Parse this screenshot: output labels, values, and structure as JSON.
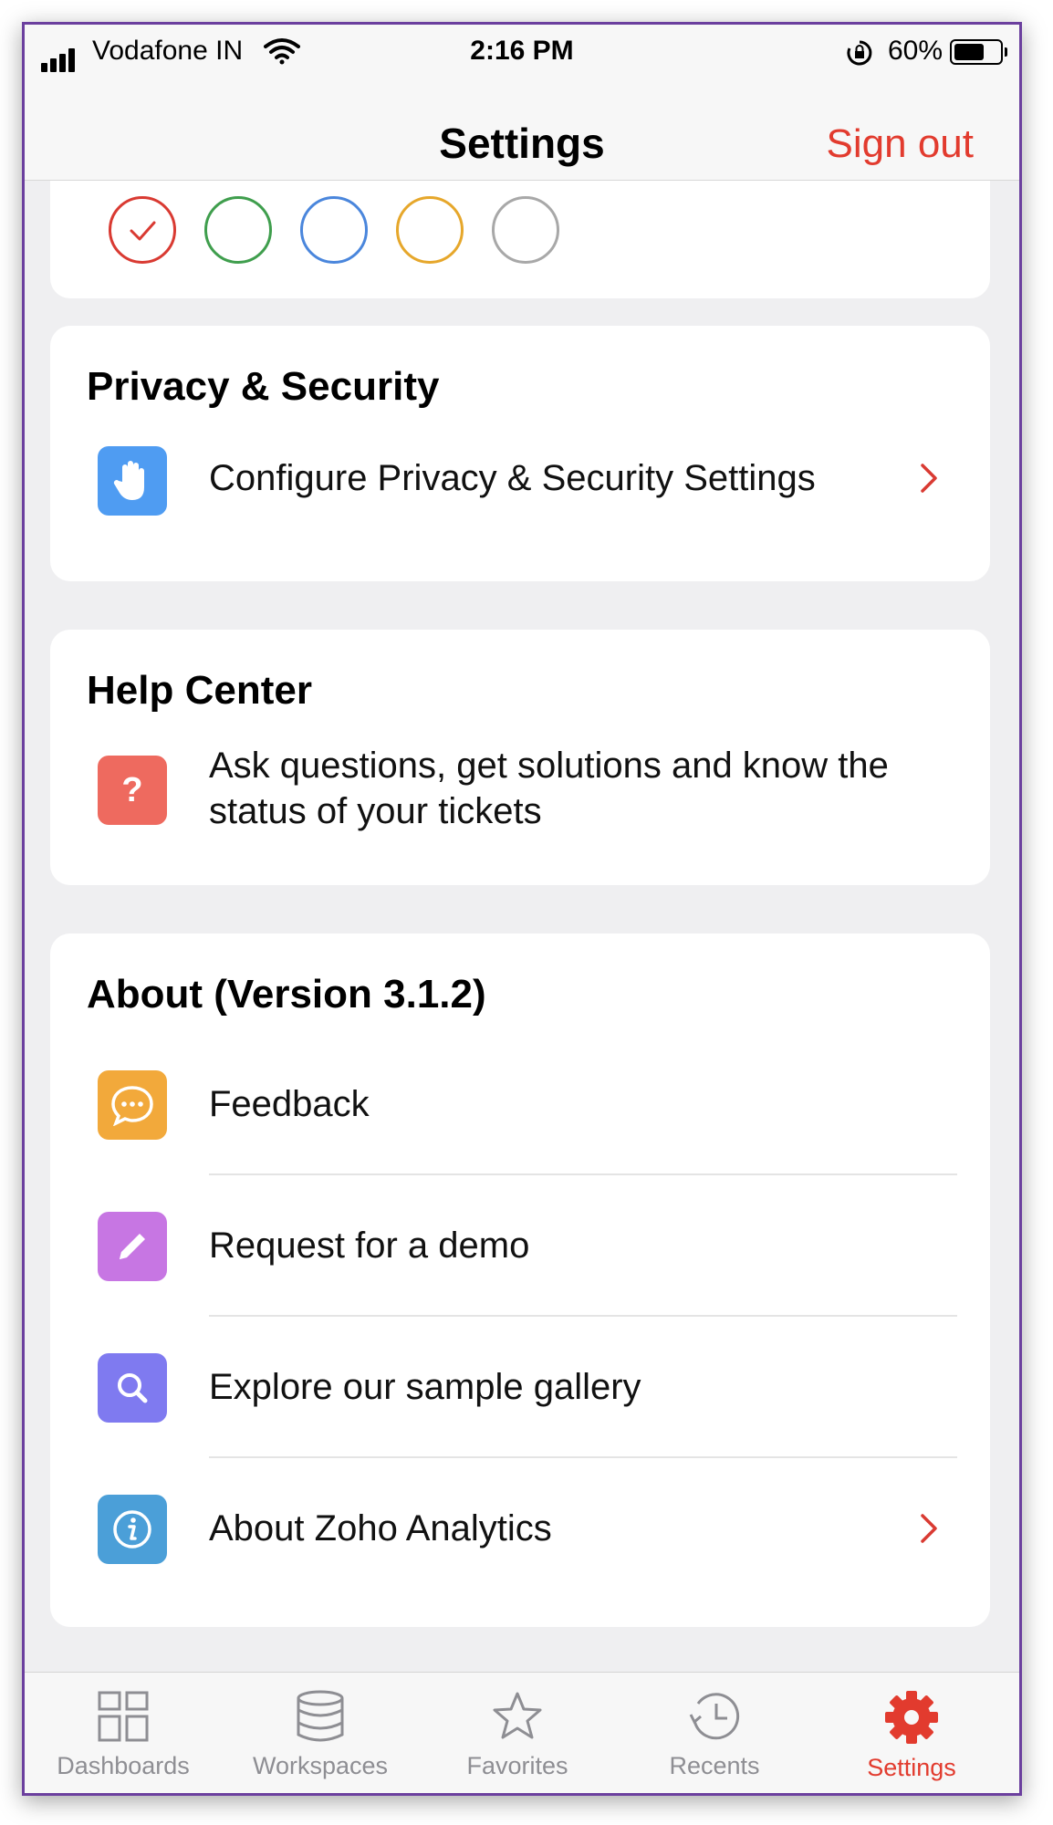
{
  "status_bar": {
    "carrier": "Vodafone IN",
    "time": "2:16 PM",
    "battery": "60%"
  },
  "nav": {
    "title": "Settings",
    "sign_out": "Sign out"
  },
  "theme_colors": [
    "#d93a32",
    "#3f9e4d",
    "#4a86dc",
    "#e6a72b",
    "#a8a8a8"
  ],
  "privacy": {
    "heading": "Privacy & Security",
    "item_label": "Configure Privacy & Security Settings",
    "icon": "hand-icon",
    "icon_color": "#4f9cf2"
  },
  "help": {
    "heading": "Help Center",
    "item_line1": "Ask questions, get solutions and know the",
    "item_line2": "status of your tickets",
    "icon": "question-icon",
    "icon_color": "#ee6a5f"
  },
  "about": {
    "heading": "About (Version 3.1.2)",
    "items": [
      {
        "label": "Feedback",
        "icon": "chat-bubble-icon",
        "color": "#f2a93b"
      },
      {
        "label": "Request for a demo",
        "icon": "pencil-icon",
        "color": "#c776e3"
      },
      {
        "label": "Explore our sample gallery",
        "icon": "search-icon",
        "color": "#7f7af0"
      },
      {
        "label": "About Zoho Analytics",
        "icon": "info-icon",
        "color": "#4b9fd8"
      }
    ]
  },
  "tabs": [
    {
      "label": "Dashboards",
      "icon": "dashboards-icon"
    },
    {
      "label": "Workspaces",
      "icon": "database-icon"
    },
    {
      "label": "Favorites",
      "icon": "star-icon"
    },
    {
      "label": "Recents",
      "icon": "history-icon"
    },
    {
      "label": "Settings",
      "icon": "gear-icon",
      "active": true
    }
  ],
  "accent_color": "#e23b2e"
}
